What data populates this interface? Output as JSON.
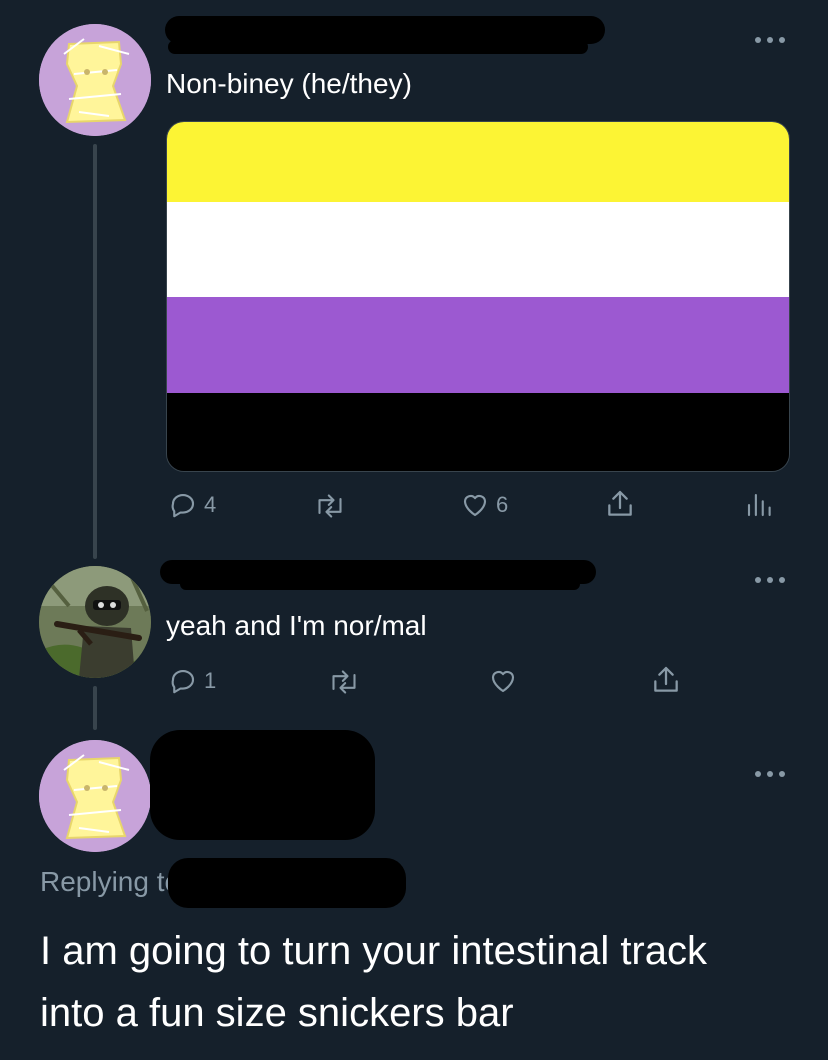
{
  "tweets": [
    {
      "bio_text": "Non-biney (he/they)",
      "actions": {
        "reply_count": "4",
        "like_count": "6"
      }
    },
    {
      "text": "yeah and I'm nor/mal",
      "actions": {
        "reply_count": "1"
      }
    },
    {
      "replying_prefix": "Replying to",
      "text_line1": "I am going to turn your intestinal track",
      "text_line2": "into a fun size snickers bar"
    }
  ],
  "flag_colors": [
    "#fcf434",
    "#ffffff",
    "#9c59d1",
    "#000000"
  ],
  "colors": {
    "background": "#15202b",
    "muted": "#8899a6",
    "divider": "#38444d"
  }
}
